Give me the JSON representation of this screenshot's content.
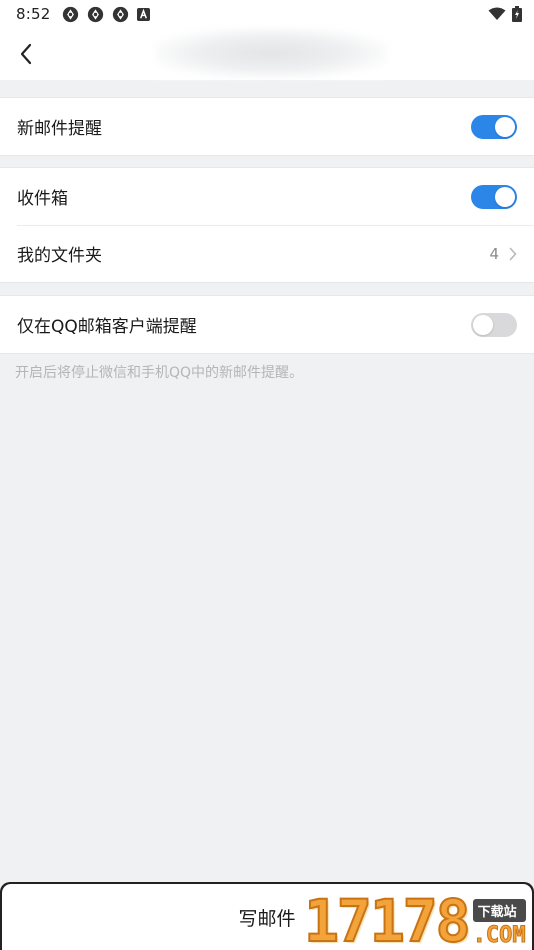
{
  "status_bar": {
    "time": "8:52",
    "notification_icons": [
      "aperture-icon",
      "aperture-icon",
      "aperture-icon",
      "font-a-icon"
    ],
    "right_icons": [
      "wifi-icon",
      "battery-charging-icon"
    ]
  },
  "nav": {
    "back_icon": "chevron-left-icon"
  },
  "settings": {
    "new_mail_alert": {
      "label": "新邮件提醒",
      "enabled": true
    },
    "inbox": {
      "label": "收件箱",
      "enabled": true
    },
    "my_folders": {
      "label": "我的文件夹",
      "count": "4"
    },
    "client_only": {
      "label": "仅在QQ邮箱客户端提醒",
      "enabled": false
    },
    "hint": "开启后将停止微信和手机QQ中的新邮件提醒。"
  },
  "compose": {
    "label": "写邮件"
  },
  "watermark": {
    "number": "17178",
    "tag": "下载站",
    "domain": ".COM"
  },
  "colors": {
    "accent": "#2b86e8",
    "toggle_off": "#d9d9dc",
    "background": "#f0f1f3"
  }
}
